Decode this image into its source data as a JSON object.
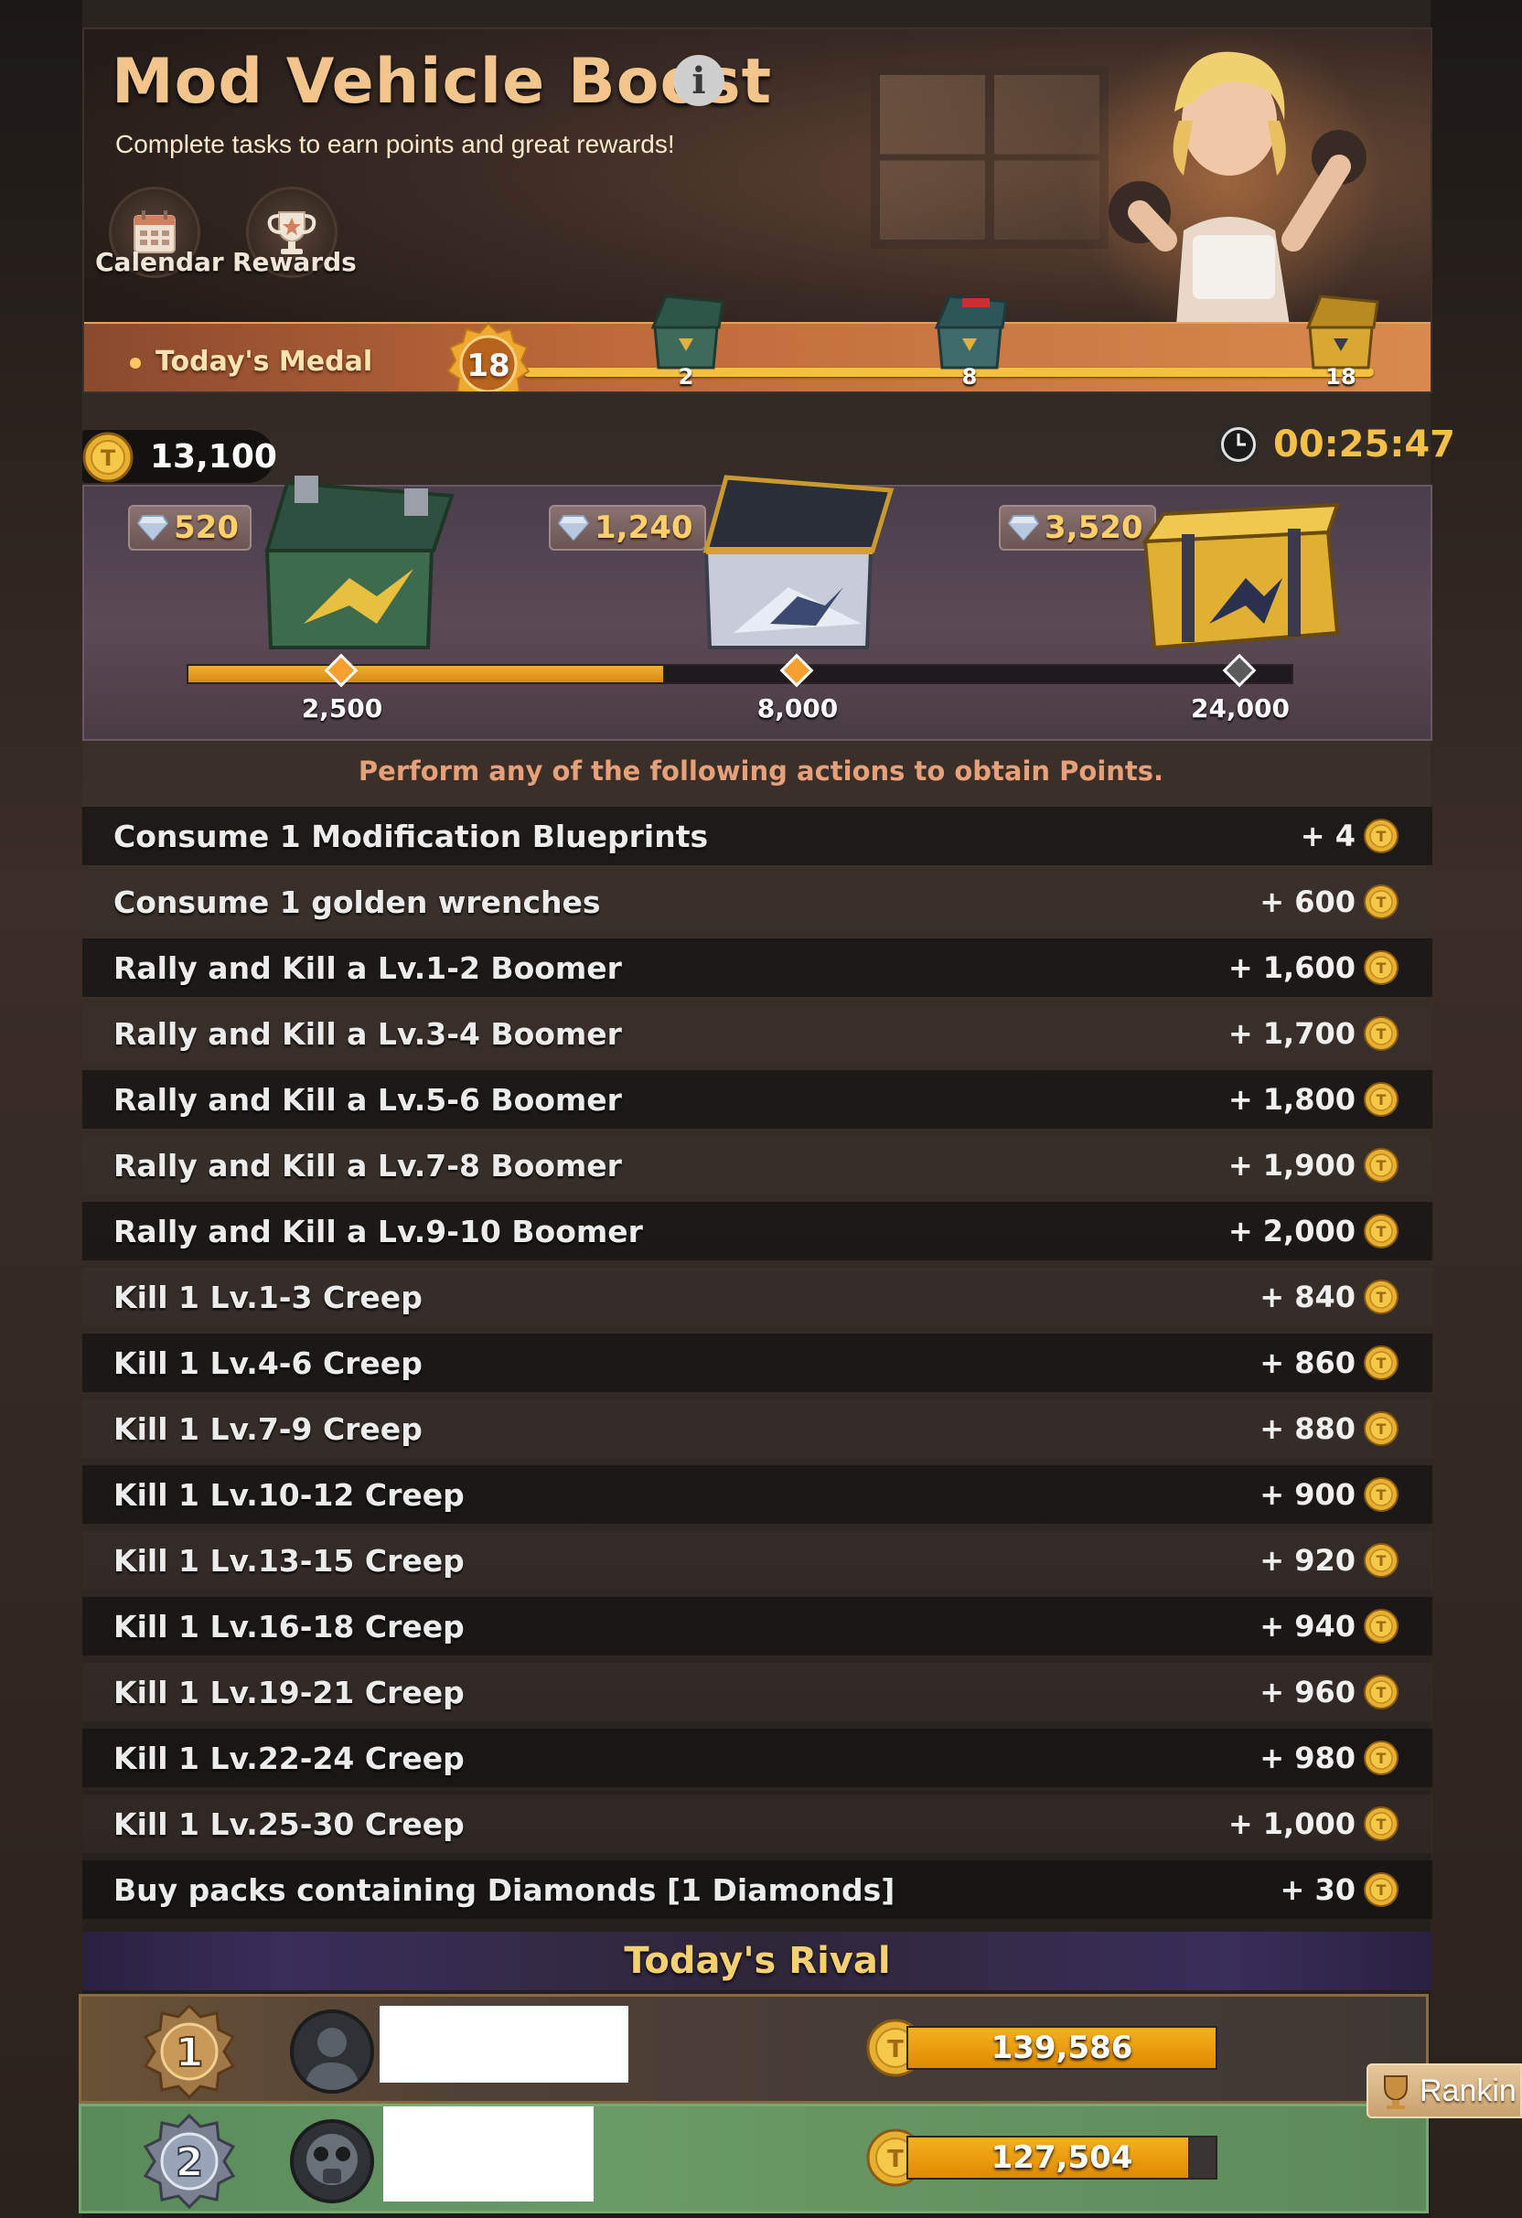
{
  "header": {
    "title": "Mod Vehicle Boost",
    "subtitle": "Complete tasks to earn points and great rewards!",
    "buttons": [
      {
        "label": "Calendar",
        "icon": "calendar-icon"
      },
      {
        "label": "Rewards",
        "icon": "trophy-icon"
      }
    ],
    "medal": {
      "label": "Today's Medal",
      "count": "18",
      "milestones": [
        "2",
        "8",
        "18"
      ]
    }
  },
  "points": {
    "current": "13,100",
    "timer": "00:25:47"
  },
  "chests": [
    {
      "diamonds": "520",
      "threshold": "2,500",
      "color": "#3f6a4a"
    },
    {
      "diamonds": "1,240",
      "threshold": "8,000",
      "color": "#b8c0d0"
    },
    {
      "diamonds": "3,520",
      "threshold": "24,000",
      "color": "#e0b030"
    }
  ],
  "progress": {
    "fraction": 0.43
  },
  "instruction": "Perform any of the following actions to obtain Points.",
  "tasks": [
    {
      "label": "Consume 1 Modification Blueprints",
      "points": "+ 4"
    },
    {
      "label": "Consume 1 golden wrenches",
      "points": "+ 600"
    },
    {
      "label": "Rally and Kill a Lv.1-2 Boomer",
      "points": "+ 1,600"
    },
    {
      "label": "Rally and Kill a Lv.3-4 Boomer",
      "points": "+ 1,700"
    },
    {
      "label": "Rally and Kill a Lv.5-6 Boomer",
      "points": "+ 1,800"
    },
    {
      "label": "Rally and Kill a Lv.7-8 Boomer",
      "points": "+ 1,900"
    },
    {
      "label": "Rally and Kill a Lv.9-10 Boomer",
      "points": "+ 2,000"
    },
    {
      "label": "Kill 1 Lv.1-3 Creep",
      "points": "+ 840"
    },
    {
      "label": "Kill 1 Lv.4-6 Creep",
      "points": "+ 860"
    },
    {
      "label": "Kill 1 Lv.7-9 Creep",
      "points": "+ 880"
    },
    {
      "label": "Kill 1 Lv.10-12 Creep",
      "points": "+ 900"
    },
    {
      "label": "Kill 1 Lv.13-15 Creep",
      "points": "+ 920"
    },
    {
      "label": "Kill 1 Lv.16-18 Creep",
      "points": "+ 940"
    },
    {
      "label": "Kill 1 Lv.19-21 Creep",
      "points": "+ 960"
    },
    {
      "label": "Kill 1 Lv.22-24 Creep",
      "points": "+ 980"
    },
    {
      "label": "Kill 1 Lv.25-30 Creep",
      "points": "+ 1,000"
    },
    {
      "label": "Buy packs containing Diamonds [1 Diamonds]",
      "points": "+ 30"
    }
  ],
  "rival": {
    "title": "Today's Rival",
    "entries": [
      {
        "rank": "1",
        "score": "139,586",
        "bar_fraction": 1.0
      },
      {
        "rank": "2",
        "score": "127,504",
        "bar_fraction": 0.91
      }
    ]
  },
  "ranking_button": {
    "label": "Rankin"
  }
}
